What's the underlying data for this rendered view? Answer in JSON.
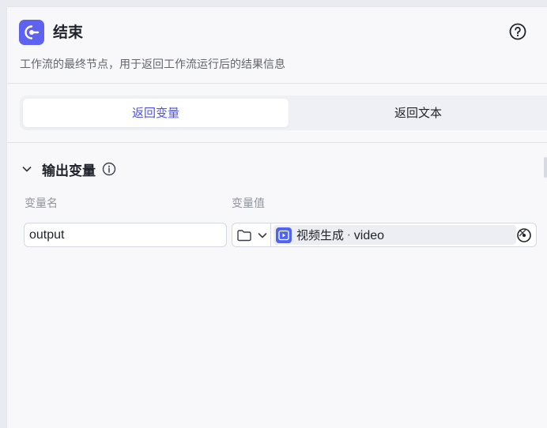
{
  "node": {
    "title": "结束",
    "description": "工作流的最终节点，用于返回工作流运行后的结果信息",
    "icon": "exit-icon",
    "accent_color": "#5f62ee"
  },
  "tabs": [
    {
      "label": "返回变量",
      "active": true
    },
    {
      "label": "返回文本",
      "active": false
    }
  ],
  "output_section": {
    "title": "输出变量",
    "columns": {
      "name": "变量名",
      "value": "变量值"
    },
    "rows": [
      {
        "name": "output",
        "type_icon": "folder-icon",
        "ref_node": "视频生成",
        "separator": "·",
        "ref_field": "video",
        "ref_icon": "video-icon",
        "ref_icon_color": "#4f65f0"
      }
    ]
  },
  "colors": {
    "tab_active_text": "#4d53e8",
    "muted_text": "#8f959e"
  }
}
